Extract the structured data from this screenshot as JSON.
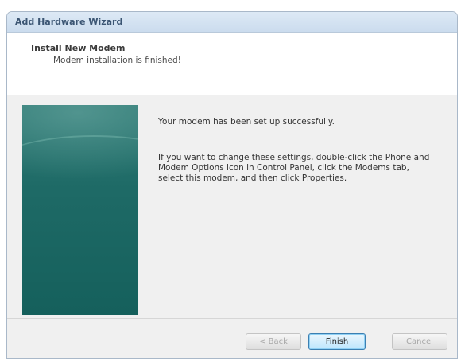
{
  "window": {
    "title": "Add Hardware Wizard"
  },
  "header": {
    "title": "Install New Modem",
    "subtitle": "Modem installation is finished!"
  },
  "content": {
    "message_success": "Your modem has been set up successfully.",
    "message_instructions": "If you want to change these settings, double-click the Phone and Modem Options icon in Control Panel, click the Modems tab, select this modem, and then click Properties."
  },
  "buttons": {
    "back": "< Back",
    "finish": "Finish",
    "cancel": "Cancel"
  },
  "colors": {
    "titlebar": "#cbdcee",
    "side_image": "#1e6a66",
    "finish_border": "#3c7fb1"
  }
}
